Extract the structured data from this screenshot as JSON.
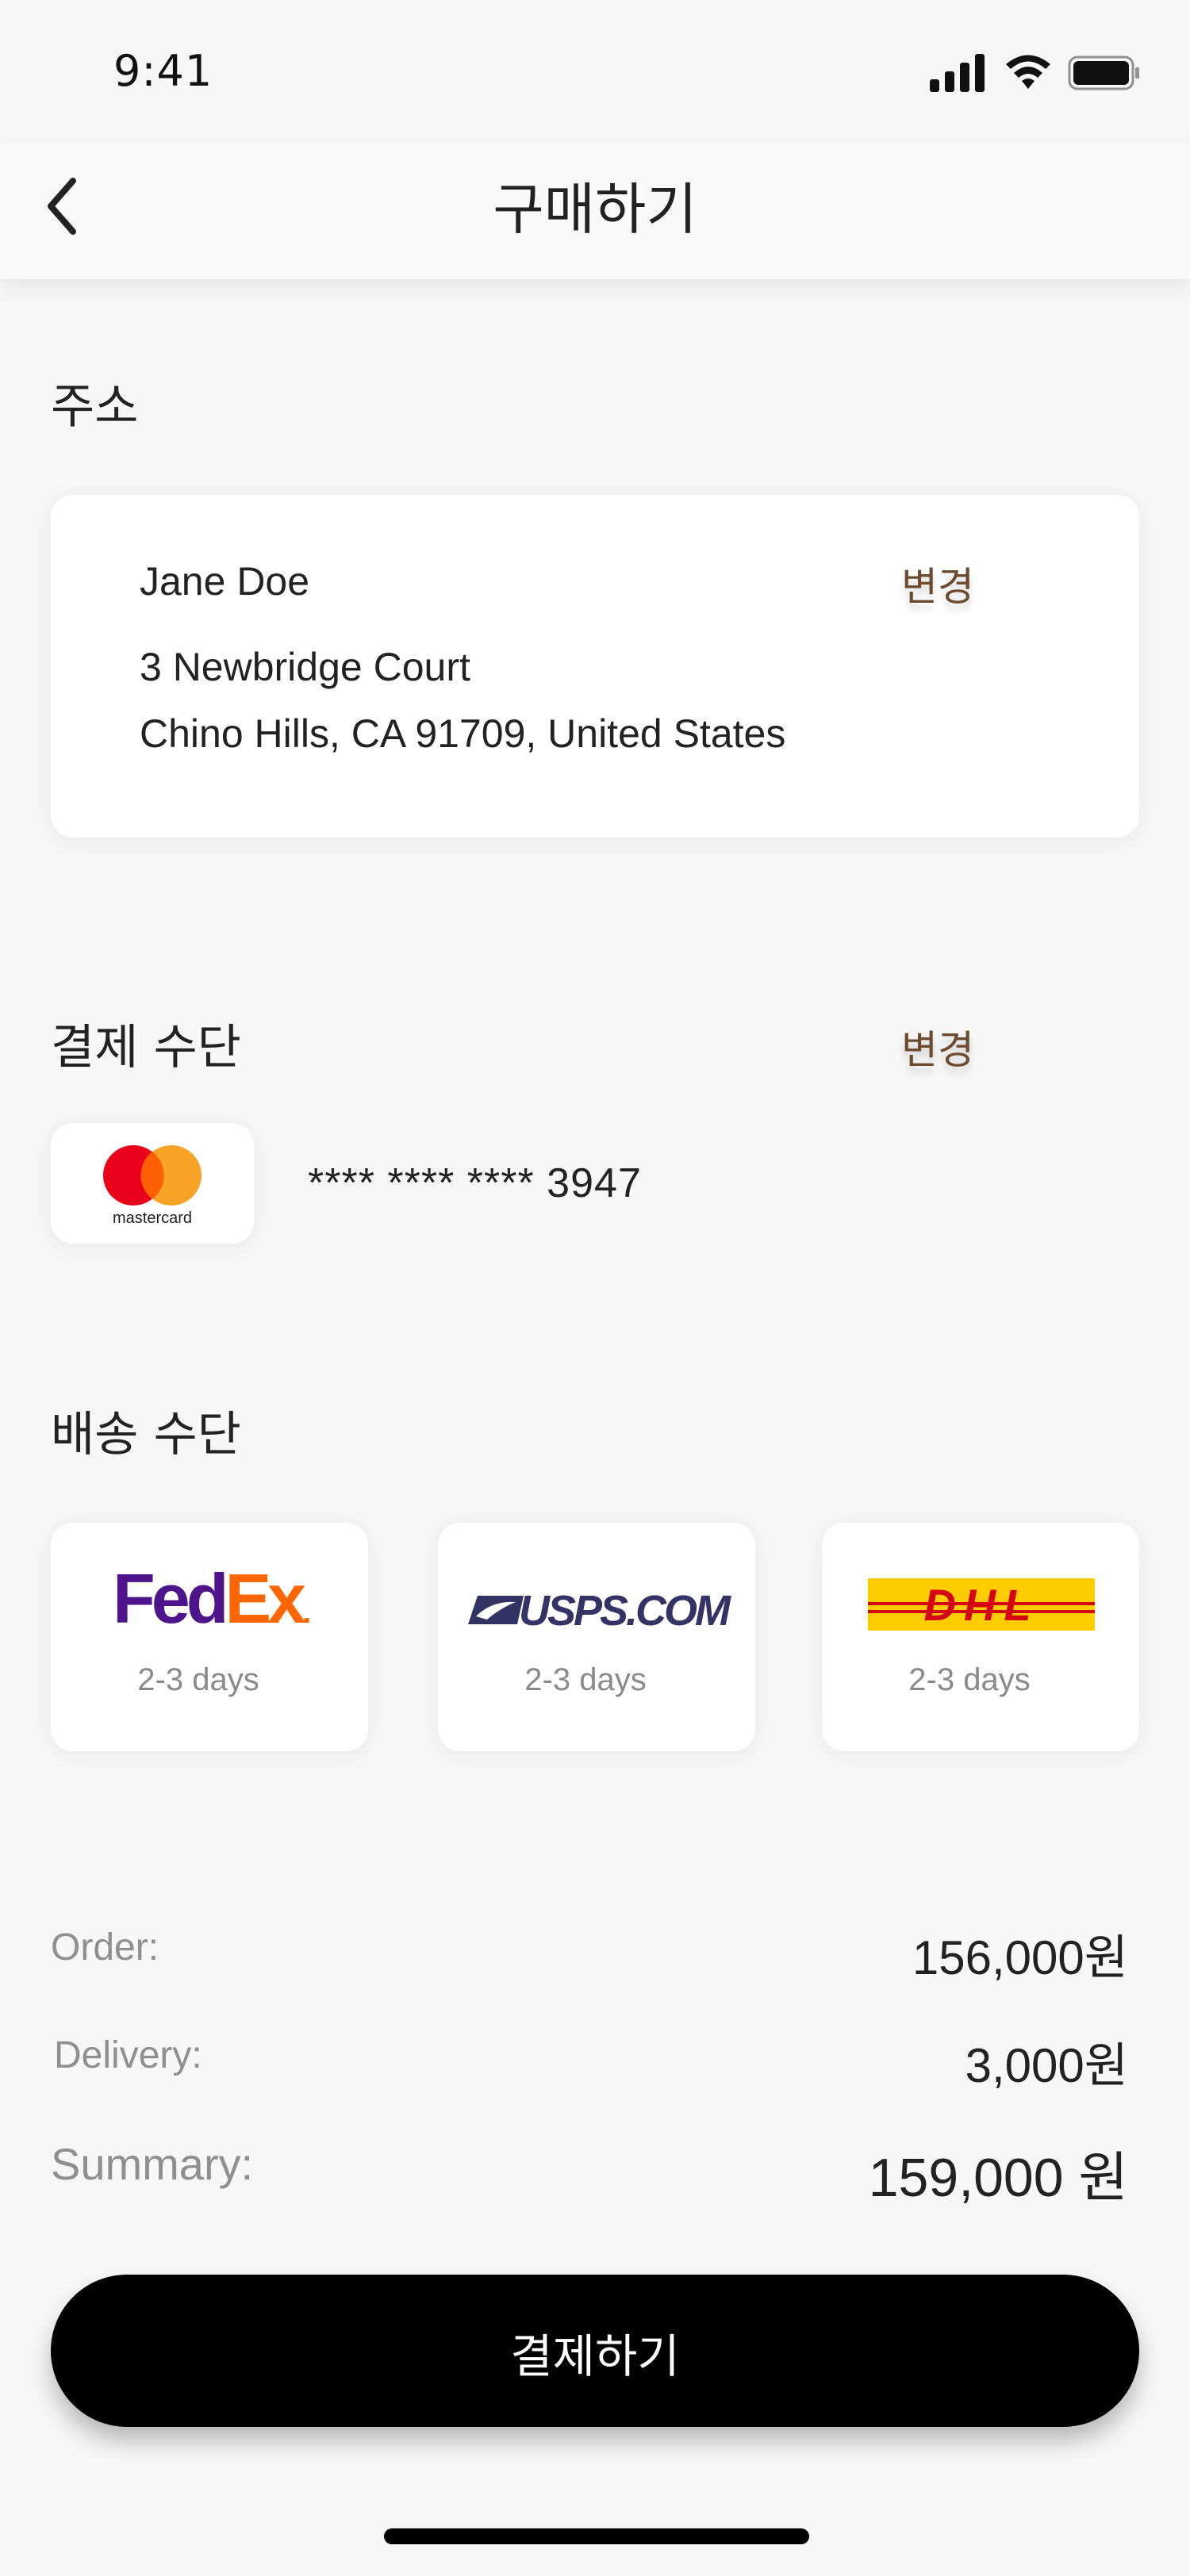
{
  "status_bar": {
    "time": "9:41"
  },
  "header": {
    "title": "구매하기"
  },
  "address": {
    "section_title": "주소",
    "name": "Jane Doe",
    "line1": "3 Newbridge Court",
    "line2": "Chino Hills, CA 91709, United States",
    "change_label": "변경"
  },
  "payment": {
    "section_title": "결제 수단",
    "change_label": "변경",
    "card_brand": "mastercard",
    "card_number": "**** **** **** 3947"
  },
  "shipping": {
    "section_title": "배송 수단",
    "options": [
      {
        "carrier": "FedEx",
        "logo_text_a": "Fed",
        "logo_text_b": "Ex",
        "logo_dot": ".",
        "days": "2-3 days"
      },
      {
        "carrier": "USPS",
        "logo_text": "USPS.COM",
        "days": "2-3 days"
      },
      {
        "carrier": "DHL",
        "logo_text": "DHL",
        "days": "2-3 days"
      }
    ]
  },
  "summary": {
    "order_label": "Order:",
    "order_value": "156,000원",
    "delivery_label": "Delivery:",
    "delivery_value": "3,000원",
    "summary_label": "Summary:",
    "summary_value": "159,000 원"
  },
  "checkout": {
    "button_label": "결제하기"
  },
  "colors": {
    "accent": "#6b4a2f",
    "fedex_purple": "#4d148c",
    "fedex_orange": "#ff6600",
    "usps_navy": "#333366",
    "dhl_yellow": "#ffcc00",
    "dhl_red": "#d40511",
    "mc_red": "#eb001b",
    "mc_orange": "#f79e1b"
  }
}
